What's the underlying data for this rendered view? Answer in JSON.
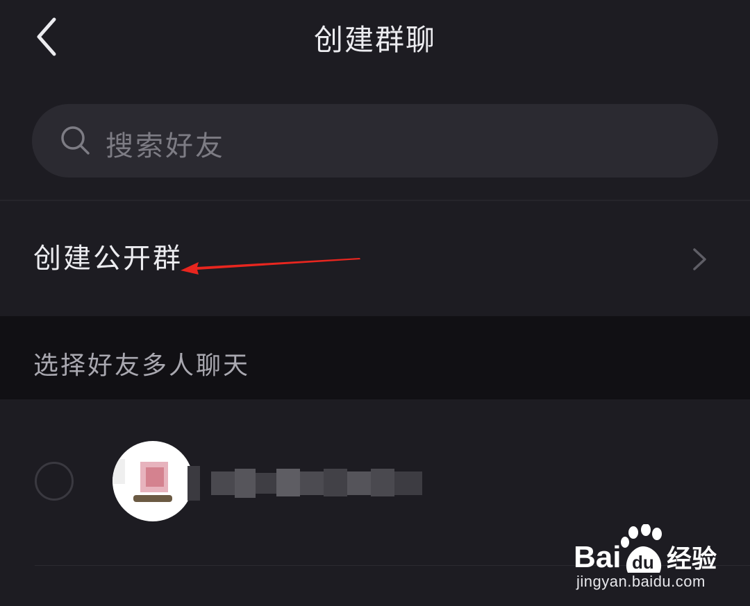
{
  "header": {
    "title": "创建群聊",
    "back_icon": "chevron-left-icon"
  },
  "search": {
    "placeholder": "搜索好友",
    "icon": "search-icon"
  },
  "public_group": {
    "label": "创建公开群",
    "chevron_icon": "chevron-right-icon"
  },
  "annotation": {
    "type": "arrow",
    "color": "#e8261f"
  },
  "section": {
    "label": "选择好友多人聊天"
  },
  "friends": [
    {
      "selected": false,
      "name_blurred": true,
      "avatar_blurred": true
    }
  ],
  "watermark": {
    "logo_text": "Baidu经验",
    "url": "jingyan.baidu.com"
  },
  "colors": {
    "background": "#1d1c22",
    "search_bg": "#2b2a31",
    "section_bg": "#111014",
    "text_primary": "#ececf0",
    "text_secondary": "#a9a8b0",
    "placeholder": "#7d7c84"
  }
}
